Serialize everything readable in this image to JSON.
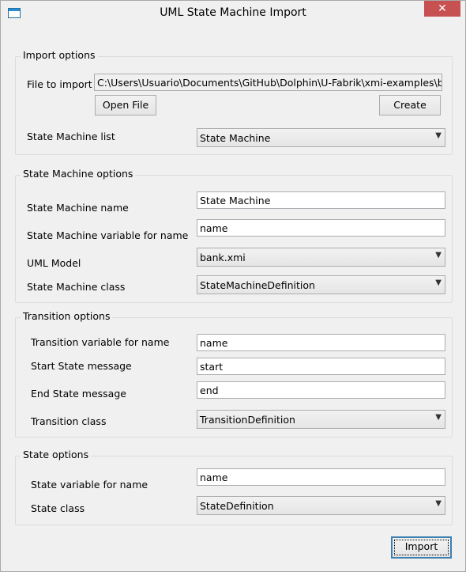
{
  "window": {
    "title": "UML State Machine Import",
    "close_glyph": "✕"
  },
  "import_options": {
    "legend": "Import options",
    "file_label": "File to import",
    "file_value": "C:\\Users\\Usuario\\Documents\\GitHub\\Dolphin\\U-Fabrik\\xmi-examples\\bank.",
    "open_file_button": "Open File",
    "create_button": "Create",
    "sm_list_label": "State Machine list",
    "sm_list_value": "State Machine"
  },
  "sm_options": {
    "legend": "State Machine options",
    "name_label": "State Machine name",
    "name_value": "State Machine",
    "var_label": "State Machine variable for name",
    "var_value": "name",
    "uml_label": "UML Model",
    "uml_value": "bank.xmi",
    "class_label": "State Machine class",
    "class_value": "StateMachineDefinition"
  },
  "transition_options": {
    "legend": "Transition options",
    "var_label": "Transition variable for name",
    "var_value": "name",
    "start_label": "Start State message",
    "start_value": "start",
    "end_label": "End State message",
    "end_value": "end",
    "class_label": "Transition class",
    "class_value": "TransitionDefinition"
  },
  "state_options": {
    "legend": "State options",
    "var_label": "State variable for name",
    "var_value": "name",
    "class_label": "State class",
    "class_value": "StateDefinition"
  },
  "import_button": "Import"
}
